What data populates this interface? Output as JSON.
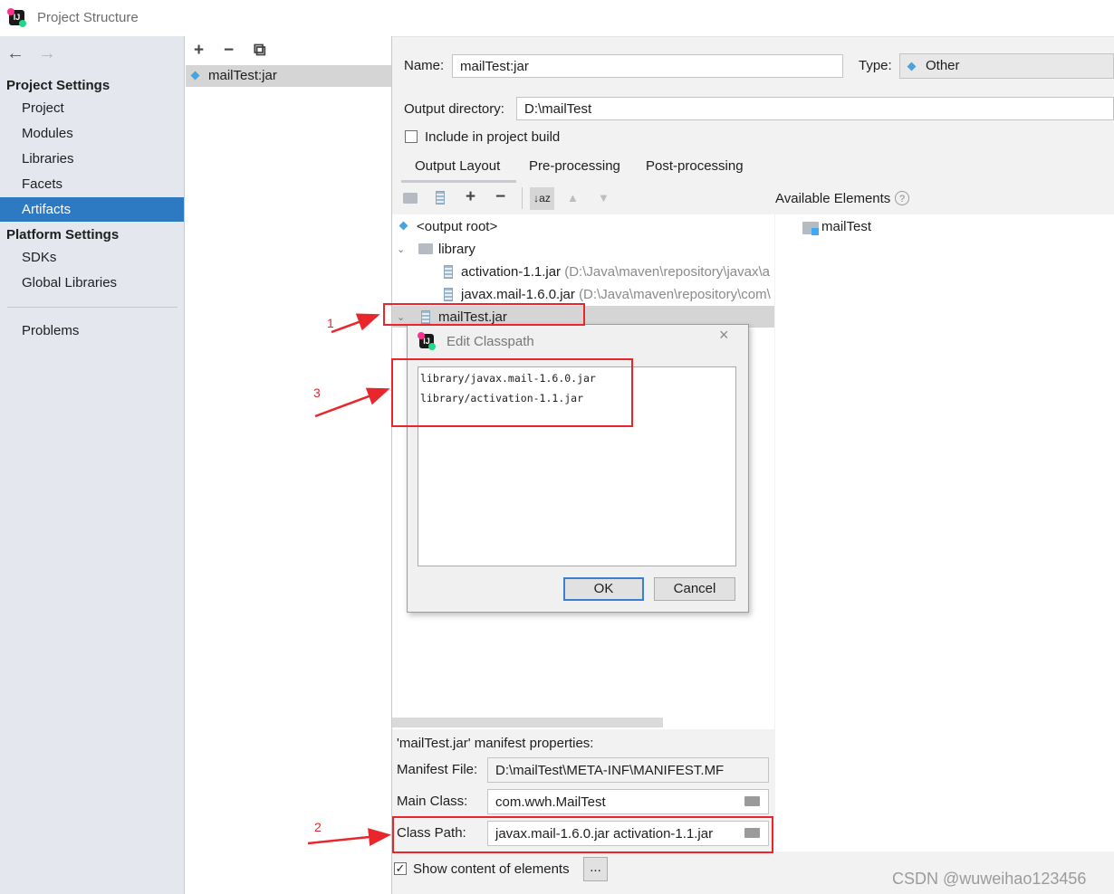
{
  "window": {
    "title": "Project Structure"
  },
  "nav": {
    "back": "←",
    "forward": "→",
    "project_settings_header": "Project Settings",
    "project_items": [
      "Project",
      "Modules",
      "Libraries",
      "Facets",
      "Artifacts"
    ],
    "platform_settings_header": "Platform Settings",
    "platform_items": [
      "SDKs",
      "Global Libraries"
    ],
    "problems": "Problems",
    "selected": "Artifacts"
  },
  "artifacts_toolbar": {
    "add": "+",
    "remove": "−",
    "copy": "⧉"
  },
  "artifacts_list": [
    "mailTest:jar"
  ],
  "form": {
    "name_label": "Name:",
    "name_value": "mailTest:jar",
    "type_label": "Type:",
    "type_value": "Other",
    "output_dir_label": "Output directory:",
    "output_dir_value": "D:\\mailTest",
    "include_build_label": "Include in project build",
    "include_build_checked": false
  },
  "tabs": [
    "Output Layout",
    "Pre-processing",
    "Post-processing"
  ],
  "active_tab": "Output Layout",
  "layout_toolbar": {
    "add": "+",
    "remove": "−",
    "sort": "↓az",
    "up": "▲",
    "down": "▼"
  },
  "tree": {
    "output_root": "<output root>",
    "library_folder": "library",
    "activation_jar": "activation-1.1.jar",
    "activation_path": "(D:\\Java\\maven\\repository\\javax\\a",
    "mail_jar": "javax.mail-1.6.0.jar",
    "mail_path": "(D:\\Java\\maven\\repository\\com\\",
    "mailtest_jar": "mailTest.jar"
  },
  "available": {
    "title": "Available Elements",
    "help": "?",
    "items": [
      "mailTest"
    ]
  },
  "dialog": {
    "title": "Edit Classpath",
    "close": "×",
    "lines": [
      "library/javax.mail-1.6.0.jar",
      "library/activation-1.1.jar"
    ],
    "ok": "OK",
    "cancel": "Cancel"
  },
  "manifest": {
    "header": "'mailTest.jar' manifest properties:",
    "file_label": "Manifest File:",
    "file_value": "D:\\mailTest\\META-INF\\MANIFEST.MF",
    "main_class_label": "Main Class:",
    "main_class_value": "com.wwh.MailTest",
    "class_path_label": "Class Path:",
    "class_path_value": "javax.mail-1.6.0.jar activation-1.1.jar"
  },
  "show_content": {
    "label": "Show content of elements",
    "checked": true,
    "button": "..."
  },
  "annotations": {
    "one": "1",
    "two": "2",
    "three": "3",
    "color": "#e8262c"
  },
  "watermark": "CSDN @wuweihao123456",
  "colors": {
    "selection": "#2d7ac2",
    "accent_red": "#e8262c"
  }
}
